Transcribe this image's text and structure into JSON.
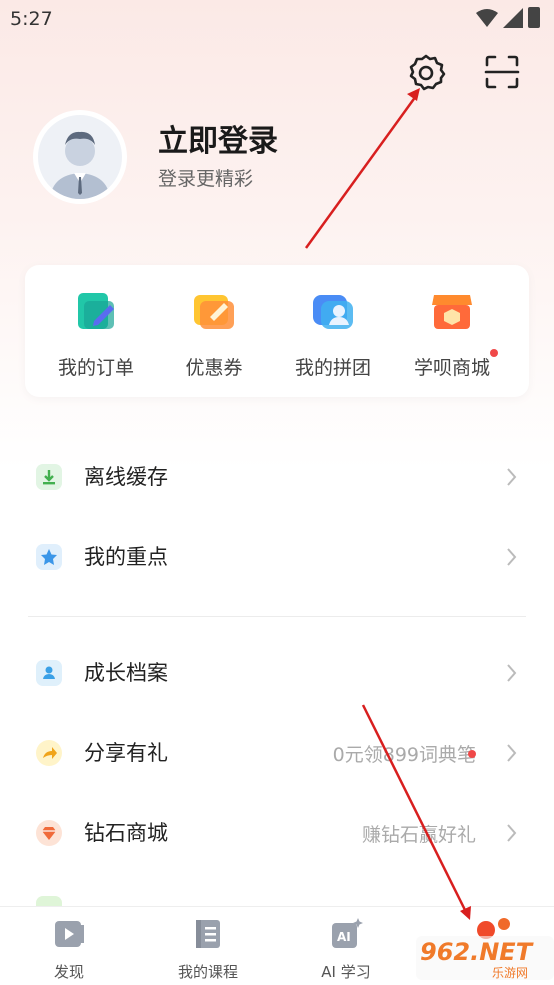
{
  "status_bar": {
    "time": "5:27"
  },
  "profile": {
    "title": "立即登录",
    "subtitle": "登录更精彩"
  },
  "quick_actions": [
    {
      "label": "我的订单",
      "icon": "order-icon"
    },
    {
      "label": "优惠券",
      "icon": "coupon-icon"
    },
    {
      "label": "我的拼团",
      "icon": "group-buy-icon"
    },
    {
      "label": "学呗商城",
      "icon": "store-icon",
      "badge": true
    }
  ],
  "menu": [
    {
      "label": "离线缓存",
      "icon": "download-icon",
      "extra": ""
    },
    {
      "label": "我的重点",
      "icon": "star-icon",
      "extra": ""
    },
    {
      "label": "成长档案",
      "icon": "profile-icon",
      "extra": ""
    },
    {
      "label": "分享有礼",
      "icon": "share-icon",
      "extra": "0元领899词典笔"
    },
    {
      "label": "钻石商城",
      "icon": "diamond-icon",
      "extra": "赚钻石赢好礼"
    }
  ],
  "tabs": [
    {
      "label": "发现",
      "icon": "discover-icon"
    },
    {
      "label": "我的课程",
      "icon": "courses-icon"
    },
    {
      "label": "AI 学习",
      "icon": "ai-icon"
    }
  ],
  "watermark": {
    "text": "962.NET",
    "sub": "乐游网"
  },
  "colors": {
    "accent_red": "#d81f1f",
    "badge": "#f04848"
  }
}
